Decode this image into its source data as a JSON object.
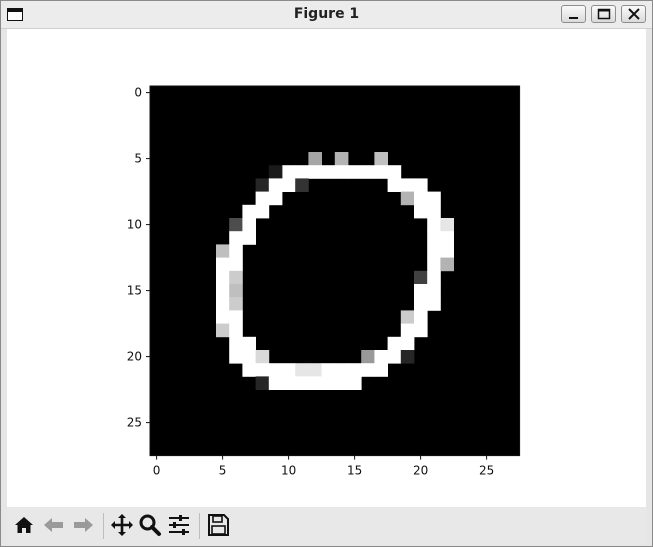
{
  "window": {
    "title": "Figure 1"
  },
  "titlebar_buttons": [
    {
      "name": "minimize-icon"
    },
    {
      "name": "maximize-icon"
    },
    {
      "name": "close-icon"
    }
  ],
  "toolbar": [
    {
      "name": "home-icon"
    },
    {
      "name": "back-arrow-icon"
    },
    {
      "name": "forward-arrow-icon"
    },
    {
      "name": "pan-move-icon"
    },
    {
      "name": "zoom-magnifier-icon"
    },
    {
      "name": "configure-subplots-icon"
    },
    {
      "name": "save-floppy-icon"
    }
  ],
  "chart_data": {
    "type": "heatmap",
    "colormap": "gray",
    "shape": [
      28,
      28
    ],
    "x_ticks": [
      "0",
      "5",
      "10",
      "15",
      "20",
      "25"
    ],
    "y_ticks": [
      "0",
      "5",
      "10",
      "15",
      "20",
      "25"
    ],
    "x_tick_values": [
      0,
      5,
      10,
      15,
      20,
      25
    ],
    "y_tick_values": [
      0,
      5,
      10,
      15,
      20,
      25
    ],
    "pixels": [
      [
        5,
        12,
        0.65
      ],
      [
        5,
        14,
        0.7
      ],
      [
        5,
        17,
        0.75
      ],
      [
        6,
        10,
        1
      ],
      [
        6,
        11,
        1
      ],
      [
        6,
        12,
        1
      ],
      [
        6,
        13,
        1
      ],
      [
        6,
        14,
        1
      ],
      [
        6,
        15,
        1
      ],
      [
        6,
        16,
        1
      ],
      [
        6,
        17,
        1
      ],
      [
        6,
        18,
        1
      ],
      [
        6,
        9,
        0.1
      ],
      [
        7,
        8,
        0.15
      ],
      [
        7,
        9,
        1
      ],
      [
        7,
        10,
        1
      ],
      [
        7,
        11,
        0.2
      ],
      [
        7,
        18,
        1
      ],
      [
        7,
        19,
        1
      ],
      [
        7,
        20,
        1
      ],
      [
        8,
        8,
        1
      ],
      [
        8,
        9,
        1
      ],
      [
        8,
        19,
        0.7
      ],
      [
        8,
        20,
        1
      ],
      [
        8,
        21,
        1
      ],
      [
        9,
        7,
        1
      ],
      [
        9,
        8,
        1
      ],
      [
        9,
        20,
        1
      ],
      [
        9,
        21,
        1
      ],
      [
        10,
        6,
        0.3
      ],
      [
        10,
        7,
        1
      ],
      [
        10,
        21,
        1
      ],
      [
        10,
        22,
        0.9
      ],
      [
        11,
        6,
        1
      ],
      [
        11,
        7,
        1
      ],
      [
        11,
        21,
        1
      ],
      [
        11,
        22,
        1
      ],
      [
        12,
        5,
        0.75
      ],
      [
        12,
        6,
        1
      ],
      [
        12,
        21,
        1
      ],
      [
        12,
        22,
        1
      ],
      [
        13,
        5,
        1
      ],
      [
        13,
        6,
        1
      ],
      [
        13,
        21,
        1
      ],
      [
        13,
        22,
        0.7
      ],
      [
        14,
        5,
        1
      ],
      [
        14,
        6,
        0.8
      ],
      [
        14,
        20,
        0.25
      ],
      [
        14,
        21,
        1
      ],
      [
        15,
        5,
        1
      ],
      [
        15,
        6,
        0.75
      ],
      [
        15,
        20,
        1
      ],
      [
        15,
        21,
        1
      ],
      [
        16,
        5,
        1
      ],
      [
        16,
        6,
        0.8
      ],
      [
        16,
        20,
        1
      ],
      [
        16,
        21,
        1
      ],
      [
        17,
        5,
        1
      ],
      [
        17,
        6,
        1
      ],
      [
        17,
        19,
        0.8
      ],
      [
        17,
        20,
        1
      ],
      [
        18,
        5,
        0.8
      ],
      [
        18,
        6,
        1
      ],
      [
        18,
        19,
        1
      ],
      [
        18,
        20,
        1
      ],
      [
        19,
        6,
        1
      ],
      [
        19,
        7,
        1
      ],
      [
        19,
        18,
        1
      ],
      [
        19,
        19,
        1
      ],
      [
        20,
        6,
        1
      ],
      [
        20,
        7,
        1
      ],
      [
        20,
        8,
        0.85
      ],
      [
        20,
        16,
        0.6
      ],
      [
        20,
        17,
        1
      ],
      [
        20,
        18,
        1
      ],
      [
        20,
        19,
        0.15
      ],
      [
        21,
        7,
        1
      ],
      [
        21,
        8,
        1
      ],
      [
        21,
        9,
        1
      ],
      [
        21,
        10,
        1
      ],
      [
        21,
        11,
        0.9
      ],
      [
        21,
        12,
        0.9
      ],
      [
        21,
        13,
        1
      ],
      [
        21,
        14,
        1
      ],
      [
        21,
        15,
        1
      ],
      [
        21,
        16,
        1
      ],
      [
        21,
        17,
        1
      ],
      [
        22,
        8,
        0.15
      ],
      [
        22,
        9,
        1
      ],
      [
        22,
        10,
        1
      ],
      [
        22,
        11,
        1
      ],
      [
        22,
        12,
        1
      ],
      [
        22,
        13,
        1
      ],
      [
        22,
        14,
        1
      ],
      [
        22,
        15,
        1
      ]
    ]
  }
}
